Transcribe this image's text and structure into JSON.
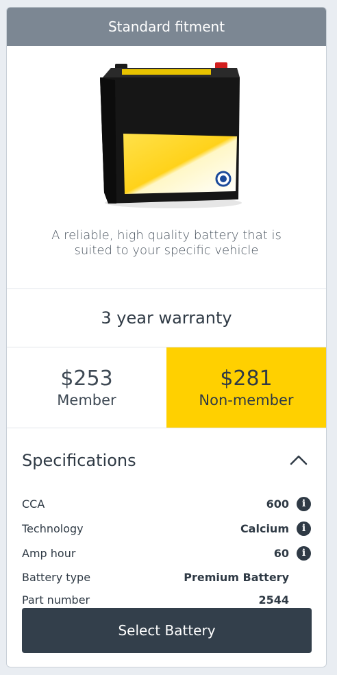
{
  "header": {
    "title": "Standard fitment"
  },
  "product": {
    "image_name": "battery-image",
    "description": "A reliable, high quality battery that is suited to your specific vehicle"
  },
  "warranty": {
    "text": "3 year warranty"
  },
  "pricing": {
    "member": {
      "amount": "$253",
      "label": "Member"
    },
    "non_member": {
      "amount": "$281",
      "label": "Non-member"
    }
  },
  "specifications": {
    "title": "Specifications",
    "toggle_icon": "chevron-up-icon",
    "rows": [
      {
        "label": "CCA",
        "value": "600",
        "info": true
      },
      {
        "label": "Technology",
        "value": "Calcium",
        "info": true
      },
      {
        "label": "Amp hour",
        "value": "60",
        "info": true
      },
      {
        "label": "Battery type",
        "value": "Premium Battery",
        "info": false
      },
      {
        "label": "Part number",
        "value": "2544",
        "info": false
      }
    ]
  },
  "actions": {
    "select_label": "Select Battery"
  },
  "colors": {
    "header_bg": "#7c8793",
    "accent_yellow": "#ffd000",
    "button_bg": "#333f4b"
  }
}
